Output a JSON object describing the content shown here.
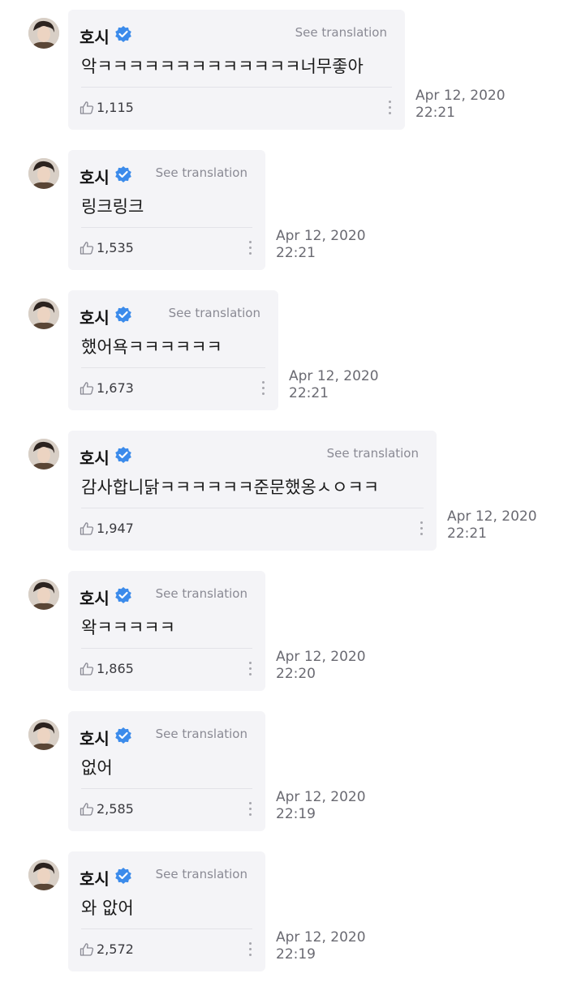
{
  "comments": [
    {
      "author": "호시",
      "verified_icon": "verified-badge-icon",
      "translate_label": "See translation",
      "text": "악ㅋㅋㅋㅋㅋㅋㅋㅋㅋㅋㅋㅋㅋ너무좋아",
      "likes": "1,115",
      "date": "Apr 12, 2020",
      "time": "22:21"
    },
    {
      "author": "호시",
      "verified_icon": "verified-badge-icon",
      "translate_label": "See translation",
      "text": "링크링크",
      "likes": "1,535",
      "date": "Apr 12, 2020",
      "time": "22:21"
    },
    {
      "author": "호시",
      "verified_icon": "verified-badge-icon",
      "translate_label": "See translation",
      "text": "했어욕ㅋㅋㅋㅋㅋㅋ",
      "likes": "1,673",
      "date": "Apr 12, 2020",
      "time": "22:21"
    },
    {
      "author": "호시",
      "verified_icon": "verified-badge-icon",
      "translate_label": "See translation",
      "text": "감사합니닭ㅋㅋㅋㅋㅋㅋ준문했옹ㅅㅇㅋㅋ",
      "likes": "1,947",
      "date": "Apr 12, 2020",
      "time": "22:21"
    },
    {
      "author": "호시",
      "verified_icon": "verified-badge-icon",
      "translate_label": "See translation",
      "text": "왁ㅋㅋㅋㅋㅋ",
      "likes": "1,865",
      "date": "Apr 12, 2020",
      "time": "22:20"
    },
    {
      "author": "호시",
      "verified_icon": "verified-badge-icon",
      "translate_label": "See translation",
      "text": "없어",
      "likes": "2,585",
      "date": "Apr 12, 2020",
      "time": "22:19"
    },
    {
      "author": "호시",
      "verified_icon": "verified-badge-icon",
      "translate_label": "See translation",
      "text": "와 앖어",
      "likes": "2,572",
      "date": "Apr 12, 2020",
      "time": "22:19"
    }
  ],
  "colors": {
    "bubble_bg": "#f4f4f7",
    "verified_blue": "#3b8beb",
    "muted_text": "#8a8a94"
  }
}
